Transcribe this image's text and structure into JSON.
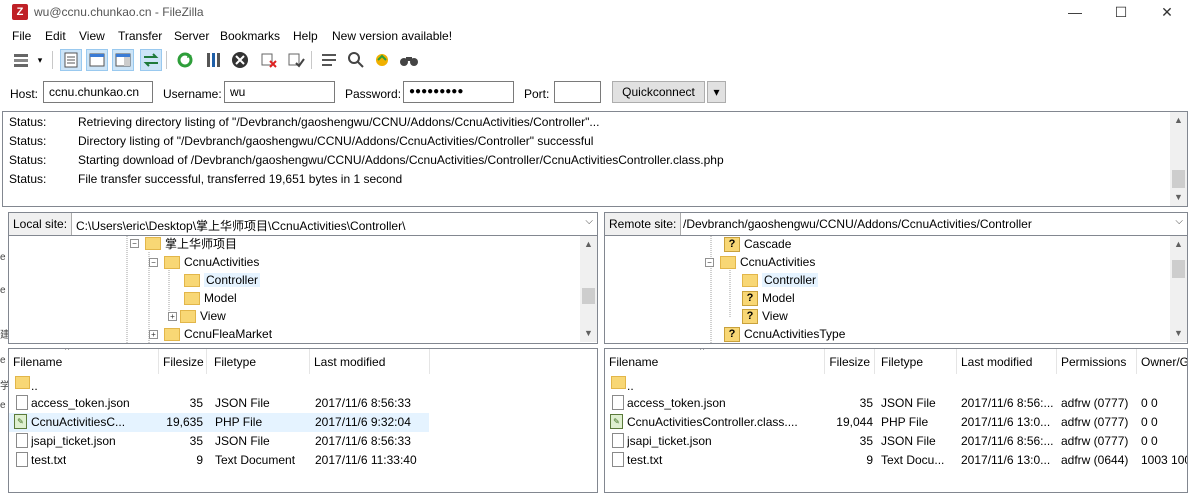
{
  "window": {
    "title": "wu@ccnu.chunkao.cn - FileZilla",
    "app_icon_letter": "Z",
    "minimize": "—",
    "maximize": "☐",
    "close": "✕"
  },
  "menu": [
    "File",
    "Edit",
    "View",
    "Transfer",
    "Server",
    "Bookmarks",
    "Help",
    "New version available!"
  ],
  "toolbar": {
    "icons": [
      "site-manager-icon",
      "dropdown-arrow-icon",
      "toggle-message-log-icon",
      "toggle-local-tree-icon",
      "toggle-remote-tree-icon",
      "toggle-transfer-queue-icon",
      "refresh-icon",
      "process-queue-icon",
      "cancel-icon",
      "disconnect-icon",
      "reconnect-icon",
      "directory-filter-icon",
      "toggle-filter-icon",
      "sync-browsing-icon",
      "search-icon"
    ]
  },
  "quickconnect": {
    "host_label": "Host:",
    "host_value": "ccnu.chunkao.cn",
    "username_label": "Username:",
    "username_value": "wu",
    "password_label": "Password:",
    "password_value": "●●●●●●●●●",
    "port_label": "Port:",
    "port_value": "",
    "button_label": "Quickconnect",
    "dropdown": "▾"
  },
  "log": [
    {
      "status": "Status:",
      "message": "Retrieving directory listing of \"/Devbranch/gaoshengwu/CCNU/Addons/CcnuActivities/Controller\"..."
    },
    {
      "status": "Status:",
      "message": "Directory listing of \"/Devbranch/gaoshengwu/CCNU/Addons/CcnuActivities/Controller\" successful"
    },
    {
      "status": "Status:",
      "message": "Starting download of /Devbranch/gaoshengwu/CCNU/Addons/CcnuActivities/Controller/CcnuActivitiesController.class.php"
    },
    {
      "status": "Status:",
      "message": "File transfer successful, transferred 19,651 bytes in 1 second"
    }
  ],
  "local_site": {
    "label": "Local site:",
    "path": "C:\\Users\\eric\\Desktop\\掌上华师项目\\CcnuActivities\\Controller\\"
  },
  "remote_site": {
    "label": "Remote site:",
    "path": "/Devbranch/gaoshengwu/CCNU/Addons/CcnuActivities/Controller"
  },
  "local_tree": [
    {
      "label": "掌上华师项目",
      "expander": "−"
    },
    {
      "label": "CcnuActivities",
      "expander": "−"
    },
    {
      "label": "Controller",
      "expander": ""
    },
    {
      "label": "Model",
      "expander": ""
    },
    {
      "label": "View",
      "expander": "+"
    },
    {
      "label": "CcnuFleaMarket",
      "expander": "+"
    }
  ],
  "remote_tree": [
    {
      "label": "Cascade",
      "marker": "?"
    },
    {
      "label": "CcnuActivities",
      "marker": ""
    },
    {
      "label": "Controller",
      "marker": ""
    },
    {
      "label": "Model",
      "marker": "?"
    },
    {
      "label": "View",
      "marker": "?"
    },
    {
      "label": "CcnuActivitiesType",
      "marker": "?"
    }
  ],
  "local_columns": [
    "Filename",
    "Filesize",
    "Filetype",
    "Last modified"
  ],
  "local_files": [
    {
      "name": "..",
      "size": "",
      "type": "",
      "modified": "",
      "icon": "folder-up"
    },
    {
      "name": "access_token.json",
      "size": "35",
      "type": "JSON File",
      "modified": "2017/11/6 8:56:33",
      "icon": "doc"
    },
    {
      "name": "CcnuActivitiesC...",
      "size": "19,635",
      "type": "PHP File",
      "modified": "2017/11/6 9:32:04",
      "icon": "php"
    },
    {
      "name": "jsapi_ticket.json",
      "size": "35",
      "type": "JSON File",
      "modified": "2017/11/6 8:56:33",
      "icon": "doc"
    },
    {
      "name": "test.txt",
      "size": "9",
      "type": "Text Document",
      "modified": "2017/11/6 11:33:40",
      "icon": "txt"
    }
  ],
  "remote_columns": [
    "Filename",
    "Filesize",
    "Filetype",
    "Last modified",
    "Permissions",
    "Owner/G"
  ],
  "remote_files": [
    {
      "name": "..",
      "size": "",
      "type": "",
      "modified": "",
      "perms": "",
      "owner": "",
      "icon": "folder-up"
    },
    {
      "name": "access_token.json",
      "size": "35",
      "type": "JSON File",
      "modified": "2017/11/6 8:56:...",
      "perms": "adfrw (0777)",
      "owner": "0 0",
      "icon": "doc"
    },
    {
      "name": "CcnuActivitiesController.class....",
      "size": "19,044",
      "type": "PHP File",
      "modified": "2017/11/6 13:0...",
      "perms": "adfrw (0777)",
      "owner": "0 0",
      "icon": "php"
    },
    {
      "name": "jsapi_ticket.json",
      "size": "35",
      "type": "JSON File",
      "modified": "2017/11/6 8:56:...",
      "perms": "adfrw (0777)",
      "owner": "0 0",
      "icon": "doc"
    },
    {
      "name": "test.txt",
      "size": "9",
      "type": "Text Docu...",
      "modified": "2017/11/6 13:0...",
      "perms": "adfrw (0644)",
      "owner": "1003 100",
      "icon": "txt"
    }
  ],
  "left_edge_chars": [
    "e",
    "e",
    "建",
    "e",
    "学",
    "e"
  ],
  "colors": {
    "selection": "#e5f3ff",
    "folder": "#f8d775",
    "app_icon": "#bf2026"
  }
}
